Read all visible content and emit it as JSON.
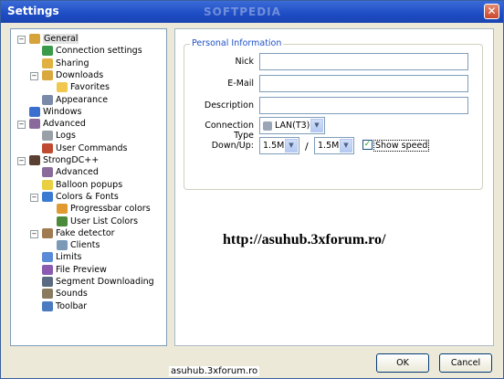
{
  "window": {
    "title": "Settings",
    "watermark": "SOFTPEDIA"
  },
  "tree": {
    "items": [
      {
        "label": "General",
        "level": 0,
        "expander": "−",
        "icon": "general-icon",
        "color": "#d6a23a"
      },
      {
        "label": "Connection settings",
        "level": 1,
        "icon": "globe-icon",
        "color": "#3a9a4a"
      },
      {
        "label": "Sharing",
        "level": 1,
        "icon": "sharing-icon",
        "color": "#e0b040"
      },
      {
        "label": "Downloads",
        "level": 1,
        "expander": "−",
        "icon": "downloads-icon",
        "color": "#d9a840"
      },
      {
        "label": "Favorites",
        "level": 2,
        "icon": "folder-icon",
        "color": "#f0c850"
      },
      {
        "label": "Appearance",
        "level": 1,
        "icon": "appearance-icon",
        "color": "#7a8aa8"
      },
      {
        "label": "Windows",
        "level": 0,
        "icon": "window-icon",
        "color": "#3a6fd0"
      },
      {
        "label": "Advanced",
        "level": 0,
        "expander": "−",
        "icon": "advanced-icon",
        "color": "#8a6a9a"
      },
      {
        "label": "Logs",
        "level": 1,
        "icon": "logs-icon",
        "color": "#9aa0a8"
      },
      {
        "label": "User Commands",
        "level": 1,
        "icon": "user-commands-icon",
        "color": "#c04a30"
      },
      {
        "label": "StrongDC++",
        "level": 0,
        "expander": "−",
        "icon": "strongdc-icon",
        "color": "#5a4030"
      },
      {
        "label": "Advanced",
        "level": 1,
        "icon": "advanced-icon",
        "color": "#8a6a9a"
      },
      {
        "label": "Balloon popups",
        "level": 1,
        "icon": "balloon-icon",
        "color": "#e8d040"
      },
      {
        "label": "Colors & Fonts",
        "level": 1,
        "expander": "−",
        "icon": "colors-icon",
        "color": "#3a7ad0"
      },
      {
        "label": "Progressbar colors",
        "level": 2,
        "icon": "progressbar-icon",
        "color": "#e09a30"
      },
      {
        "label": "User List Colors",
        "level": 2,
        "icon": "userlist-icon",
        "color": "#4a8a3a"
      },
      {
        "label": "Fake detector",
        "level": 1,
        "expander": "−",
        "icon": "fake-detector-icon",
        "color": "#a07a50"
      },
      {
        "label": "Clients",
        "level": 2,
        "icon": "clients-icon",
        "color": "#7a9ab8"
      },
      {
        "label": "Limits",
        "level": 1,
        "icon": "limits-icon",
        "color": "#5a8ad8"
      },
      {
        "label": "File Preview",
        "level": 1,
        "icon": "file-preview-icon",
        "color": "#8a5ab0"
      },
      {
        "label": "Segment Downloading",
        "level": 1,
        "icon": "segment-icon",
        "color": "#5a6a80"
      },
      {
        "label": "Sounds",
        "level": 1,
        "icon": "sounds-icon",
        "color": "#8a7a60"
      },
      {
        "label": "Toolbar",
        "level": 1,
        "icon": "toolbar-icon",
        "color": "#4a7ac0"
      }
    ]
  },
  "personal": {
    "legend": "Personal Information",
    "nick_label": "Nick",
    "email_label": "E-Mail",
    "description_label": "Description",
    "connection_type_label": "Connection Type",
    "connection_type_value": "LAN(T3)",
    "downup_label": "Down/Up:",
    "down_value": "1.5M",
    "separator": "/",
    "up_value": "1.5M",
    "show_speed_label": "Show speed",
    "show_speed_checked": true
  },
  "overlay_url": "http://asuhub.3xforum.ro/",
  "buttons": {
    "ok": "OK",
    "cancel": "Cancel"
  },
  "footer": "asuhub.3xforum.ro"
}
